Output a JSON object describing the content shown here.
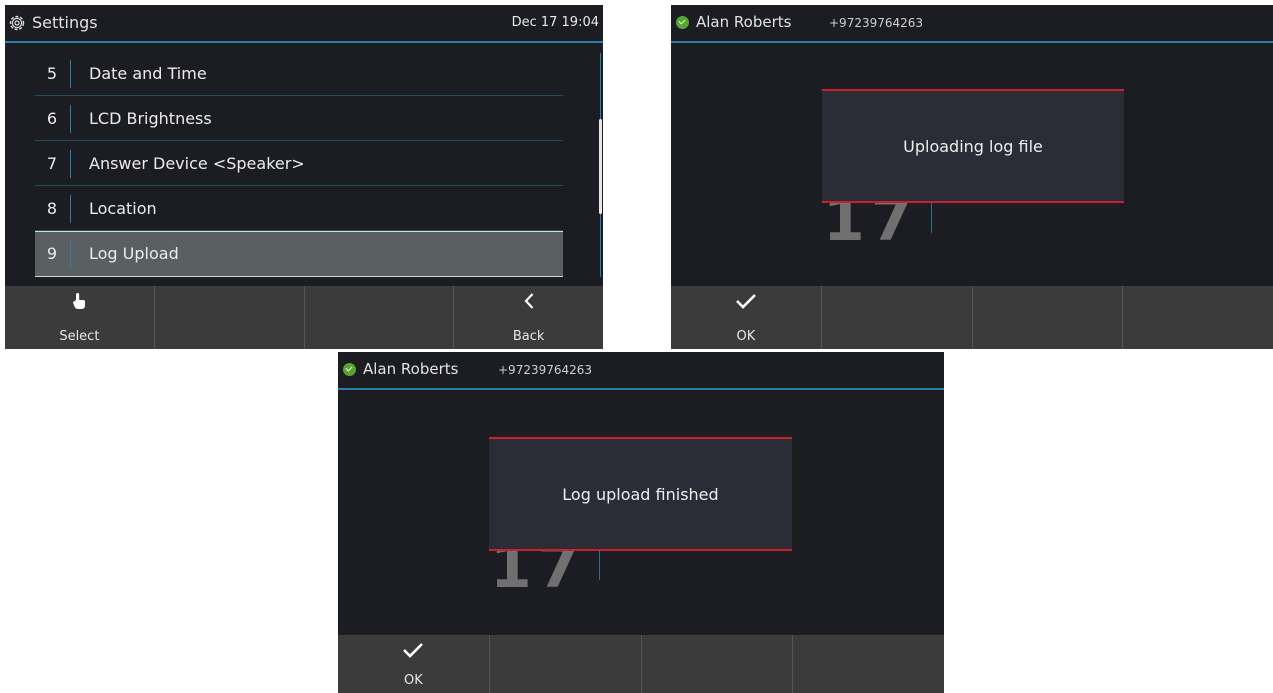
{
  "screen1": {
    "title": "Settings",
    "datetime": "Dec 17 19:04",
    "items": [
      {
        "num": "5",
        "label": "Date and Time"
      },
      {
        "num": "6",
        "label": "LCD Brightness"
      },
      {
        "num": "7",
        "label": "Answer Device <Speaker>"
      },
      {
        "num": "8",
        "label": "Location"
      },
      {
        "num": "9",
        "label": "Log Upload"
      }
    ],
    "selected_index": 4,
    "softkeys": {
      "select": "Select",
      "back": "Back",
      "select_icon": "hand-pointer-icon",
      "back_icon": "chevron-left-icon"
    }
  },
  "screen2": {
    "user_name": "Alan Roberts",
    "phone_number": "+97239764263",
    "background_number": "17",
    "dialog_message": "Uploading log file",
    "softkeys": {
      "ok": "OK",
      "ok_icon": "checkmark-icon"
    }
  },
  "screen3": {
    "user_name": "Alan Roberts",
    "phone_number": "+97239764263",
    "background_number": "17",
    "dialog_message": "Log upload finished",
    "softkeys": {
      "ok": "OK",
      "ok_icon": "checkmark-icon"
    }
  },
  "colors": {
    "accent": "#2d7ea8",
    "dialog_border": "#c8202c",
    "status_online": "#5aa531",
    "background": "#1c1d23"
  }
}
